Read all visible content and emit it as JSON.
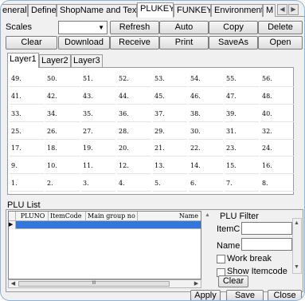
{
  "top_tabs": [
    {
      "label": "eneral",
      "active": false
    },
    {
      "label": "Define",
      "active": false
    },
    {
      "label": "ShopName and Text",
      "active": false
    },
    {
      "label": "PLUKEY",
      "active": true
    },
    {
      "label": "FUNKEY",
      "active": false
    },
    {
      "label": "Environment",
      "active": false
    },
    {
      "label": "M",
      "active": false
    }
  ],
  "toolbar": {
    "scales_label": "Scales",
    "scales_value": "",
    "row1": [
      "Refresh",
      "Auto",
      "Copy",
      "Delete"
    ],
    "row2": [
      "Clear",
      "Download",
      "Receive",
      "Print",
      "SaveAs",
      "Open"
    ]
  },
  "layers": {
    "tabs": [
      "Layer1",
      "Layer2",
      "Layer3"
    ],
    "active_index": 0,
    "grid_rows": [
      [
        "49.",
        "50.",
        "51.",
        "52.",
        "53.",
        "54.",
        "55.",
        "56."
      ],
      [
        "41.",
        "42.",
        "43.",
        "44.",
        "45.",
        "46.",
        "47.",
        "48."
      ],
      [
        "33.",
        "34.",
        "35.",
        "36.",
        "37.",
        "38.",
        "39.",
        "40."
      ],
      [
        "25.",
        "26.",
        "27.",
        "28.",
        "29.",
        "30.",
        "31.",
        "32."
      ],
      [
        "17.",
        "18.",
        "19.",
        "20.",
        "21.",
        "22.",
        "23.",
        "24."
      ],
      [
        "9.",
        "10.",
        "11.",
        "12.",
        "13.",
        "14.",
        "15.",
        "16."
      ],
      [
        "1.",
        "2.",
        "3.",
        "4.",
        "5.",
        "6.",
        "7.",
        "8."
      ]
    ]
  },
  "plu_list": {
    "title": "PLU List",
    "columns": [
      "PLUNO",
      "ItemCode",
      "Main group no",
      "Name"
    ],
    "row_indicator": "▶",
    "scroll_thumb_text": "III"
  },
  "plu_filter": {
    "title": "PLU Filter",
    "itemcode_label": "ItemC",
    "itemcode_value": "",
    "name_label": "Name",
    "name_value": "",
    "work_break_label": "Work break",
    "show_itemcode_label": "Show Itemcode",
    "clear_label": "Clear"
  },
  "bottom_buttons": [
    "Apply",
    "Save",
    "Close"
  ]
}
